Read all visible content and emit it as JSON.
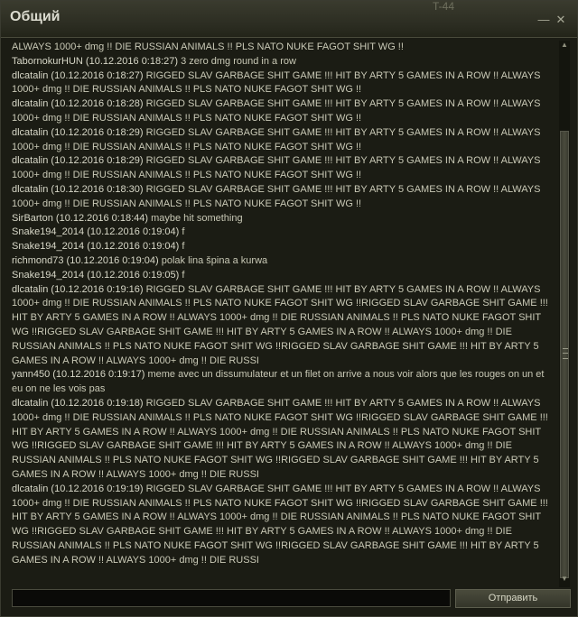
{
  "window": {
    "title": "Общий",
    "minimize_glyph": "—",
    "close_glyph": "✕",
    "title_decoration": "T-44"
  },
  "chat": {
    "messages": [
      {
        "sender": "",
        "text": "ALWAYS 1000+ dmg !! DIE RUSSIAN ANIMALS !! PLS NATO NUKE FAGOT SHIT WG !!"
      },
      {
        "sender": "TabornokurHUN (10.12.2016 0:18:27) ",
        "text": "3 zero dmg round in a row"
      },
      {
        "sender": "dlcatalin (10.12.2016 0:18:27) ",
        "text": "RIGGED SLAV GARBAGE SHIT GAME !!! HIT BY ARTY 5 GAMES IN A ROW !! ALWAYS 1000+ dmg !! DIE RUSSIAN ANIMALS !! PLS NATO NUKE FAGOT SHIT WG !!"
      },
      {
        "sender": "dlcatalin (10.12.2016 0:18:28) ",
        "text": "RIGGED SLAV GARBAGE SHIT GAME !!! HIT BY ARTY 5 GAMES IN A ROW !! ALWAYS 1000+ dmg !! DIE RUSSIAN ANIMALS !! PLS NATO NUKE FAGOT SHIT WG !!"
      },
      {
        "sender": "dlcatalin (10.12.2016 0:18:29) ",
        "text": "RIGGED SLAV GARBAGE SHIT GAME !!! HIT BY ARTY 5 GAMES IN A ROW !! ALWAYS 1000+ dmg !! DIE RUSSIAN ANIMALS !! PLS NATO NUKE FAGOT SHIT WG !!"
      },
      {
        "sender": "dlcatalin (10.12.2016 0:18:29) ",
        "text": "RIGGED SLAV GARBAGE SHIT GAME !!! HIT BY ARTY 5 GAMES IN A ROW !! ALWAYS 1000+ dmg !! DIE RUSSIAN ANIMALS !! PLS NATO NUKE FAGOT SHIT WG !!"
      },
      {
        "sender": "dlcatalin (10.12.2016 0:18:30) ",
        "text": "RIGGED SLAV GARBAGE SHIT GAME !!! HIT BY ARTY 5 GAMES IN A ROW !! ALWAYS 1000+ dmg !! DIE RUSSIAN ANIMALS !! PLS NATO NUKE FAGOT SHIT WG !!"
      },
      {
        "sender": "SirBarton (10.12.2016 0:18:44) ",
        "text": "maybe hit something"
      },
      {
        "sender": "Snake194_2014 (10.12.2016 0:19:04) ",
        "text": "f"
      },
      {
        "sender": "Snake194_2014 (10.12.2016 0:19:04) ",
        "text": "f"
      },
      {
        "sender": "richmond73 (10.12.2016 0:19:04) ",
        "text": "polak lina špina a kurwa"
      },
      {
        "sender": "Snake194_2014 (10.12.2016 0:19:05) ",
        "text": "f"
      },
      {
        "sender": "dlcatalin (10.12.2016 0:19:16) ",
        "text": "RIGGED SLAV GARBAGE SHIT GAME !!! HIT BY ARTY 5 GAMES IN A ROW !! ALWAYS 1000+ dmg !! DIE RUSSIAN ANIMALS !! PLS NATO NUKE FAGOT SHIT WG !!RIGGED SLAV GARBAGE SHIT GAME !!! HIT BY ARTY 5 GAMES IN A ROW !! ALWAYS 1000+ dmg !! DIE RUSSIAN ANIMALS !! PLS NATO NUKE FAGOT SHIT WG !!RIGGED SLAV GARBAGE SHIT GAME !!! HIT BY ARTY 5 GAMES IN A ROW !! ALWAYS 1000+ dmg !! DIE RUSSIAN ANIMALS !! PLS NATO NUKE FAGOT SHIT WG !!RIGGED SLAV GARBAGE SHIT GAME !!! HIT BY ARTY 5 GAMES IN A ROW !! ALWAYS 1000+ dmg !! DIE RUSSI"
      },
      {
        "sender": "yann450 (10.12.2016 0:19:17) ",
        "text": "meme avec un dissumulateur et un filet on arrive a nous voir alors que les rouges on un et eu on ne les vois pas"
      },
      {
        "sender": "dlcatalin (10.12.2016 0:19:18) ",
        "text": "RIGGED SLAV GARBAGE SHIT GAME !!! HIT BY ARTY 5 GAMES IN A ROW !! ALWAYS 1000+ dmg !! DIE RUSSIAN ANIMALS !! PLS NATO NUKE FAGOT SHIT WG !!RIGGED SLAV GARBAGE SHIT GAME !!! HIT BY ARTY 5 GAMES IN A ROW !! ALWAYS 1000+ dmg !! DIE RUSSIAN ANIMALS !! PLS NATO NUKE FAGOT SHIT WG !!RIGGED SLAV GARBAGE SHIT GAME !!! HIT BY ARTY 5 GAMES IN A ROW !! ALWAYS 1000+ dmg !! DIE RUSSIAN ANIMALS !! PLS NATO NUKE FAGOT SHIT WG !!RIGGED SLAV GARBAGE SHIT GAME !!! HIT BY ARTY 5 GAMES IN A ROW !! ALWAYS 1000+ dmg !! DIE RUSSI"
      },
      {
        "sender": "dlcatalin (10.12.2016 0:19:19) ",
        "text": "RIGGED SLAV GARBAGE SHIT GAME !!! HIT BY ARTY 5 GAMES IN A ROW !! ALWAYS 1000+ dmg !! DIE RUSSIAN ANIMALS !! PLS NATO NUKE FAGOT SHIT WG !!RIGGED SLAV GARBAGE SHIT GAME !!! HIT BY ARTY 5 GAMES IN A ROW !! ALWAYS 1000+ dmg !! DIE RUSSIAN ANIMALS !! PLS NATO NUKE FAGOT SHIT WG !!RIGGED SLAV GARBAGE SHIT GAME !!! HIT BY ARTY 5 GAMES IN A ROW !! ALWAYS 1000+ dmg !! DIE RUSSIAN ANIMALS !! PLS NATO NUKE FAGOT SHIT WG !!RIGGED SLAV GARBAGE SHIT GAME !!! HIT BY ARTY 5 GAMES IN A ROW !! ALWAYS 1000+ dmg !! DIE RUSSI"
      }
    ]
  },
  "input": {
    "value": "",
    "send_label": "Отправить"
  },
  "scrollbar": {
    "up_glyph": "▲",
    "down_glyph": "▼"
  }
}
